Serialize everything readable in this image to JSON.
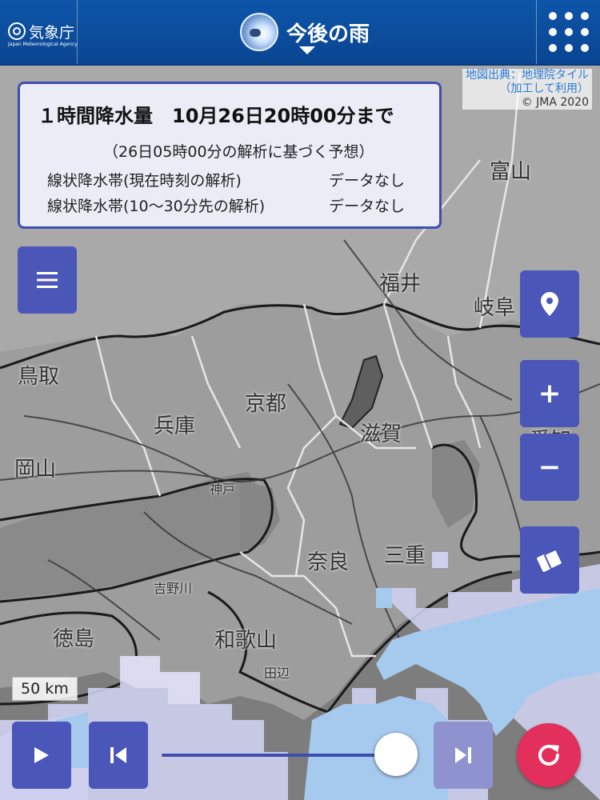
{
  "header": {
    "logo_ja": "気象庁",
    "logo_en": "Japan Meteorological Agency",
    "title": "今後の雨",
    "menu_icon": "grid-dots-icon"
  },
  "attribution": {
    "line1": "地図出典：地理院タイル",
    "line2": "（加工して利用）",
    "line3": "© JMA 2020"
  },
  "info_panel": {
    "title": "１時間降水量　10月26日20時00分まで",
    "subtitle": "（26日05時00分の解析に基づく予想）",
    "rows": [
      {
        "label": "線状降水帯(現在時刻の解析)",
        "value": "データなし"
      },
      {
        "label": "線状降水帯(10〜30分先の解析)",
        "value": "データなし"
      }
    ]
  },
  "places": {
    "toyama": "富山",
    "fukui": "福井",
    "gifu": "岐阜",
    "tottori": "鳥取",
    "kyoto": "京都",
    "hyogo": "兵庫",
    "shiga": "滋賀",
    "aichi": "愛知",
    "okayama": "岡山",
    "nara": "奈良",
    "mie": "三重",
    "tokushima": "徳島",
    "wakayama": "和歌山",
    "tanabe": "田辺",
    "kobe": "神戸",
    "yoshino": "吉野川"
  },
  "scale_label": "50 km",
  "controls": {
    "menu_icon": "hamburger-icon",
    "location_icon": "map-pin-icon",
    "zoom_in": "+",
    "zoom_out": "−",
    "layer_icon": "layers-icon",
    "play_icon": "play-icon",
    "step_back_icon": "step-back-icon",
    "step_forward_icon": "step-forward-icon",
    "reload_icon": "reload-icon"
  },
  "timeline": {
    "position": 0.97
  },
  "colors": {
    "header": "#0d55a8",
    "button": "#4a56b8",
    "panel_border": "#3f4fb0",
    "reload": "#e22f5c",
    "rain_light": "#cfd0f0",
    "rain_blue": "#a6c9ee"
  }
}
